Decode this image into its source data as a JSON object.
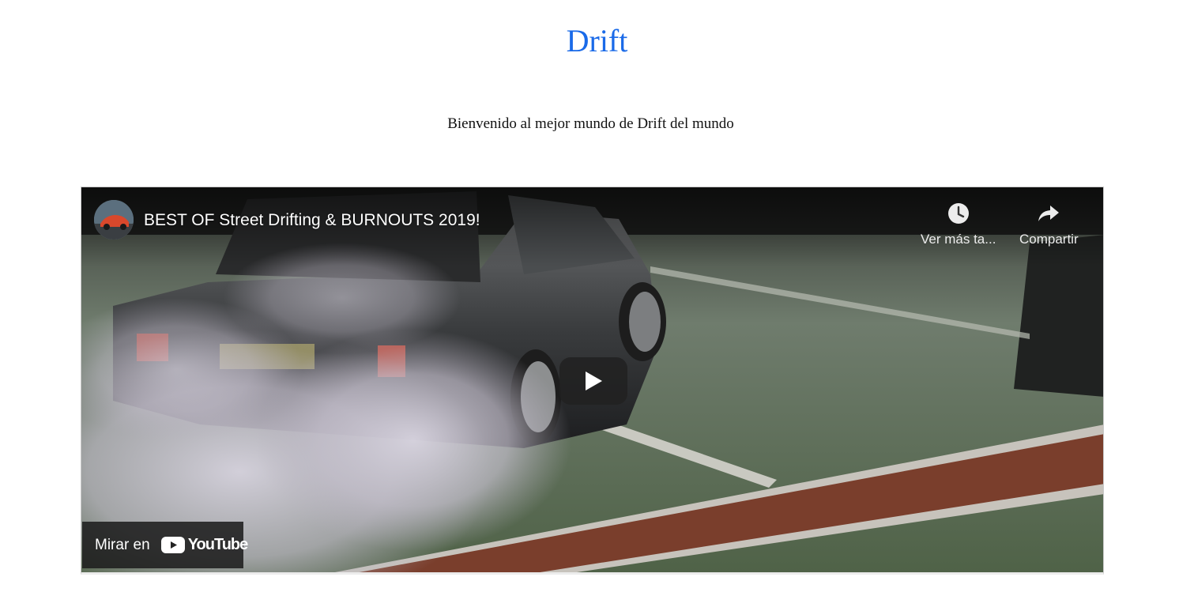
{
  "page": {
    "heading": "Drift",
    "welcome_text": "Bienvenido al mejor mundo de Drift del mundo"
  },
  "video": {
    "title": "BEST OF Street Drifting & BURNOUTS 2019!",
    "watch_later_label": "Ver más ta...",
    "share_label": "Compartir",
    "watch_on_label": "Mirar en",
    "youtube_logo_text": "YouTube",
    "icons": {
      "avatar": "channel-avatar",
      "watch_later": "clock-icon",
      "share": "share-arrow-icon",
      "play": "play-icon",
      "youtube": "youtube-play-icon"
    }
  },
  "colors": {
    "heading": "#1a6ae8",
    "youtube_red": "#ffffff"
  }
}
